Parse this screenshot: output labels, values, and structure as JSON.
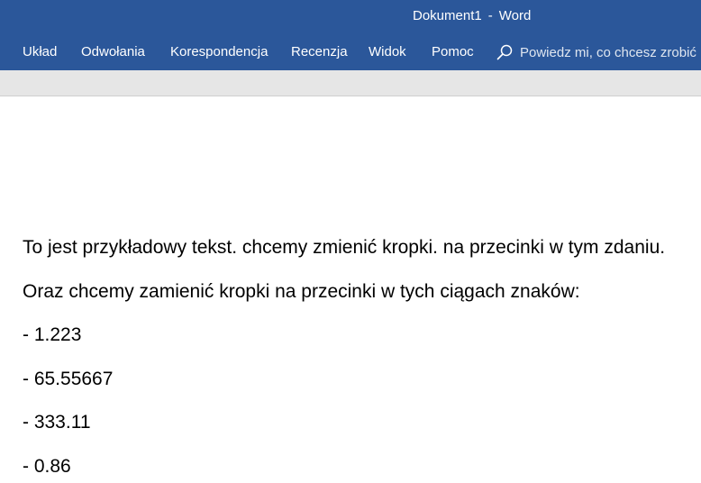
{
  "window": {
    "doc_name": "Dokument1",
    "separator": "-",
    "app_name": "Word"
  },
  "ribbon": {
    "tabs": [
      {
        "label": "Układ"
      },
      {
        "label": "Odwołania"
      },
      {
        "label": "Korespondencja"
      },
      {
        "label": "Recenzja"
      },
      {
        "label": "Widok"
      },
      {
        "label": "Pomoc"
      }
    ],
    "tell_me": {
      "icon": "search-icon",
      "text": "Powiedz mi, co chcesz zrobić"
    }
  },
  "document": {
    "paragraphs": [
      {
        "text": "To jest przykładowy tekst. chcemy zmienić kropki. na przecinki w tym zdaniu."
      },
      {
        "text": "Oraz chcemy zamienić kropki na przecinki w tych ciągach znaków:"
      },
      {
        "text": "- 1.223"
      },
      {
        "text": "- 65.55667"
      },
      {
        "text": "- 333.11"
      },
      {
        "text": "- 0.86"
      }
    ]
  },
  "colors": {
    "ribbon": "#2b579a",
    "strip": "#e6e6e6",
    "page": "#ffffff"
  }
}
